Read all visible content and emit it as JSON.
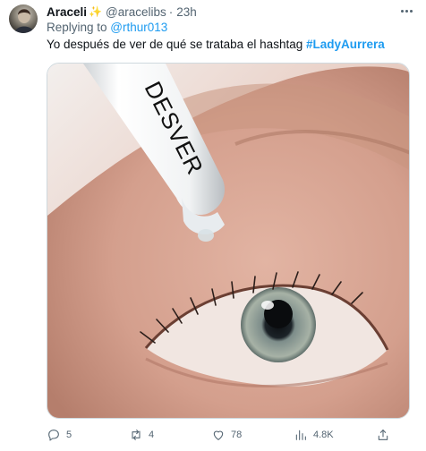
{
  "tweet": {
    "display_name": "Araceli",
    "name_emoji": "✨",
    "handle": "@aracelibs",
    "separator": "·",
    "time": "23h",
    "reply_prefix": "Replying to ",
    "reply_to": "@rthur013",
    "text": "Yo después de ver de qué se trataba el hashtag ",
    "hashtag": "#LadyAurrera",
    "image": {
      "dropper_label": "DESVER",
      "icon": "eye-drop-photo"
    },
    "actions": {
      "replies": "5",
      "retweets": "4",
      "likes": "78",
      "views": "4.8K"
    }
  },
  "colors": {
    "accent": "#1d9bf0",
    "secondary_text": "#536471",
    "primary_text": "#0f1419",
    "border": "#cfd9de"
  }
}
